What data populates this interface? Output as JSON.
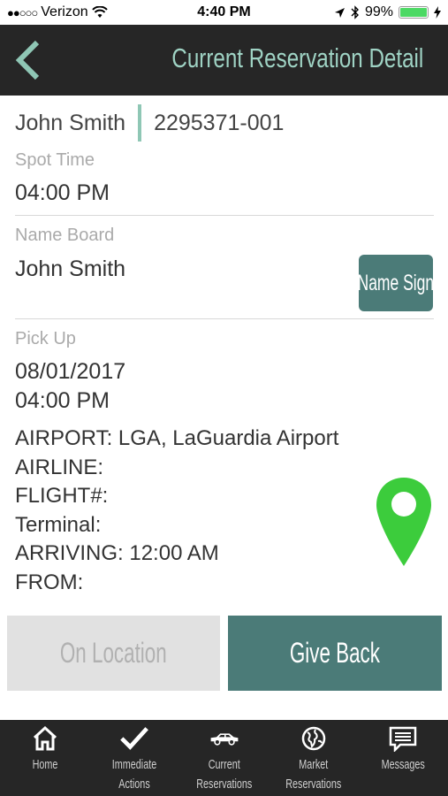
{
  "status_bar": {
    "signal_dots": "●●○○○",
    "carrier": "Verizon",
    "time": "4:40 PM",
    "battery_percent": "99%",
    "battery_level": 0.99
  },
  "header": {
    "title": "Current Reservation Detail",
    "back_icon": "chevron-left-icon"
  },
  "reservation": {
    "passenger_name": "John Smith",
    "confirmation_number": "2295371-001",
    "spot_time_label": "Spot Time",
    "spot_time": "04:00 PM",
    "name_board_label": "Name Board",
    "name_board": "John Smith",
    "name_sign_button": "Name Sign",
    "pick_up_label": "Pick Up",
    "pick_up_date": "08/01/2017",
    "pick_up_time": "04:00 PM",
    "airport": "AIRPORT: LGA, LaGuardia Airport",
    "airline": "AIRLINE:",
    "flight": "FLIGHT#:",
    "terminal": "Terminal:",
    "arriving": "ARRIVING: 12:00 AM",
    "from": "FROM:"
  },
  "actions": {
    "on_location": "On Location",
    "give_back": "Give Back"
  },
  "tabs": [
    {
      "icon": "home-icon",
      "line1": "Home",
      "line2": ""
    },
    {
      "icon": "checkmark-icon",
      "line1": "Immediate",
      "line2": "Actions"
    },
    {
      "icon": "car-icon",
      "line1": "Current",
      "line2": "Reservations"
    },
    {
      "icon": "globe-icon",
      "line1": "Market",
      "line2": "Reservations"
    },
    {
      "icon": "messages-icon",
      "line1": "Messages",
      "line2": ""
    }
  ],
  "colors": {
    "header_bg": "#262626",
    "accent_mint": "#9fd3c4",
    "teal_button": "#4b7b78",
    "pin_green": "#3ccc3c",
    "disabled_button": "#e1e1e1"
  }
}
